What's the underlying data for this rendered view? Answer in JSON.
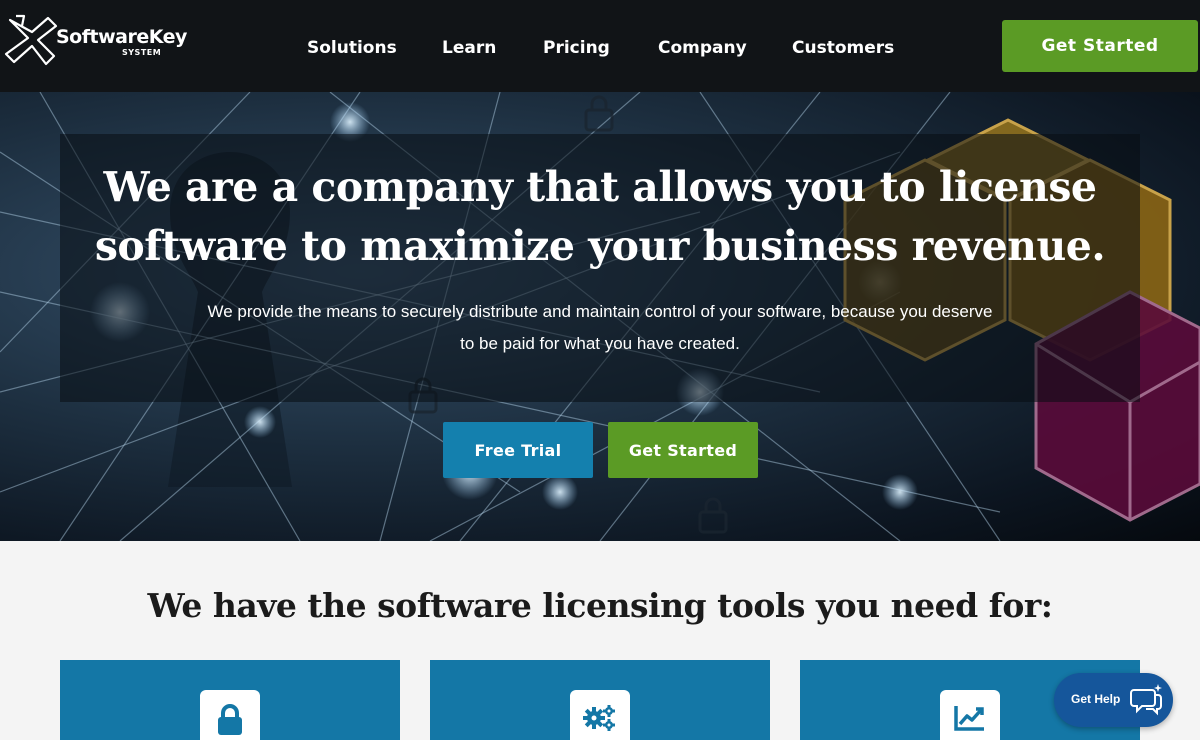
{
  "header": {
    "logo_text": "SoftwareKey",
    "logo_sub": "SYSTEM",
    "nav": [
      {
        "label": "Solutions"
      },
      {
        "label": "Learn"
      },
      {
        "label": "Pricing"
      },
      {
        "label": "Company"
      },
      {
        "label": "Customers"
      }
    ],
    "cta_label": "Get Started"
  },
  "hero": {
    "title": "We are a company that allows you to license software to maximize your business revenue.",
    "subtitle": "We provide the means to securely distribute and maintain control of your software, because you deserve to be paid for what you have created.",
    "trial_label": "Free Trial",
    "start_label": "Get Started"
  },
  "tools": {
    "title": "We have the software licensing tools you need for:",
    "cards": [
      {
        "icon": "lock-icon"
      },
      {
        "icon": "gears-icon"
      },
      {
        "icon": "chart-line-icon"
      }
    ]
  },
  "help": {
    "label": "Get Help",
    "icon": "chat-bubbles-icon"
  },
  "colors": {
    "header_bg": "#111417",
    "green": "#5b9b25",
    "blue": "#1480ae",
    "card_blue": "#1477a6",
    "help_blue": "#15569b"
  }
}
